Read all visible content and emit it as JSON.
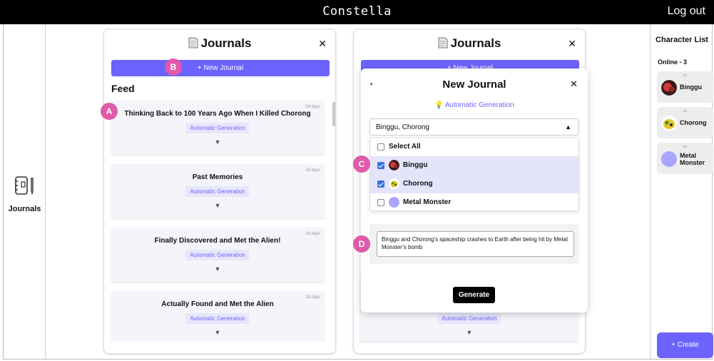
{
  "app": {
    "title": "Constella",
    "logout_label": "Log out"
  },
  "left_nav": {
    "items": [
      {
        "label": "Journals",
        "icon": "journal-icon"
      }
    ]
  },
  "panel_left": {
    "title": "Journals",
    "new_journal_label": "+ New Journal",
    "feed_label": "Feed",
    "cards": [
      {
        "title": "Thinking Back to 100 Years Ago When I Killed Chorong",
        "age": "18 days",
        "tag": "Automatic Generation"
      },
      {
        "title": "Past Memories",
        "age": "18 days",
        "tag": "Automatic Generation"
      },
      {
        "title": "Finally Discovered and Met the Alien!",
        "age": "18 days",
        "tag": "Automatic Generation"
      },
      {
        "title": "Actually Found and Met the Alien",
        "age": "18 days",
        "tag": "Automatic Generation"
      }
    ]
  },
  "panel_right": {
    "title": "Journals",
    "new_journal_label": "+ New Journal",
    "bottom_tag": "Automatic Generation"
  },
  "modal": {
    "back_icon": "◂",
    "title": "New Journal",
    "mode_label": "💡 Automatic Generation",
    "select_value": "Binggu, Chorong",
    "options": [
      {
        "label": "Select All",
        "checked": false
      },
      {
        "label": "Binggu",
        "checked": true
      },
      {
        "label": "Chorong",
        "checked": true
      },
      {
        "label": "Metal Monster",
        "checked": false
      }
    ],
    "prompt_text": "Binggu and Chorong’s spaceship crashes to Earth after being hit by Metal Monster’s bomb",
    "generate_label": "Generate"
  },
  "character_list": {
    "title": "Character List",
    "online_label": "Online - 3",
    "characters": [
      {
        "name": "Binggu"
      },
      {
        "name": "Chorong"
      },
      {
        "name": "Metal Monster"
      }
    ],
    "create_label": "+ Create"
  },
  "markers": {
    "a": "A",
    "b": "B",
    "c": "C",
    "d": "D"
  },
  "colors": {
    "accent": "#6c63ff",
    "marker": "#e05aa8",
    "selected_row": "#e4e4fb",
    "topbar": "#000000"
  }
}
